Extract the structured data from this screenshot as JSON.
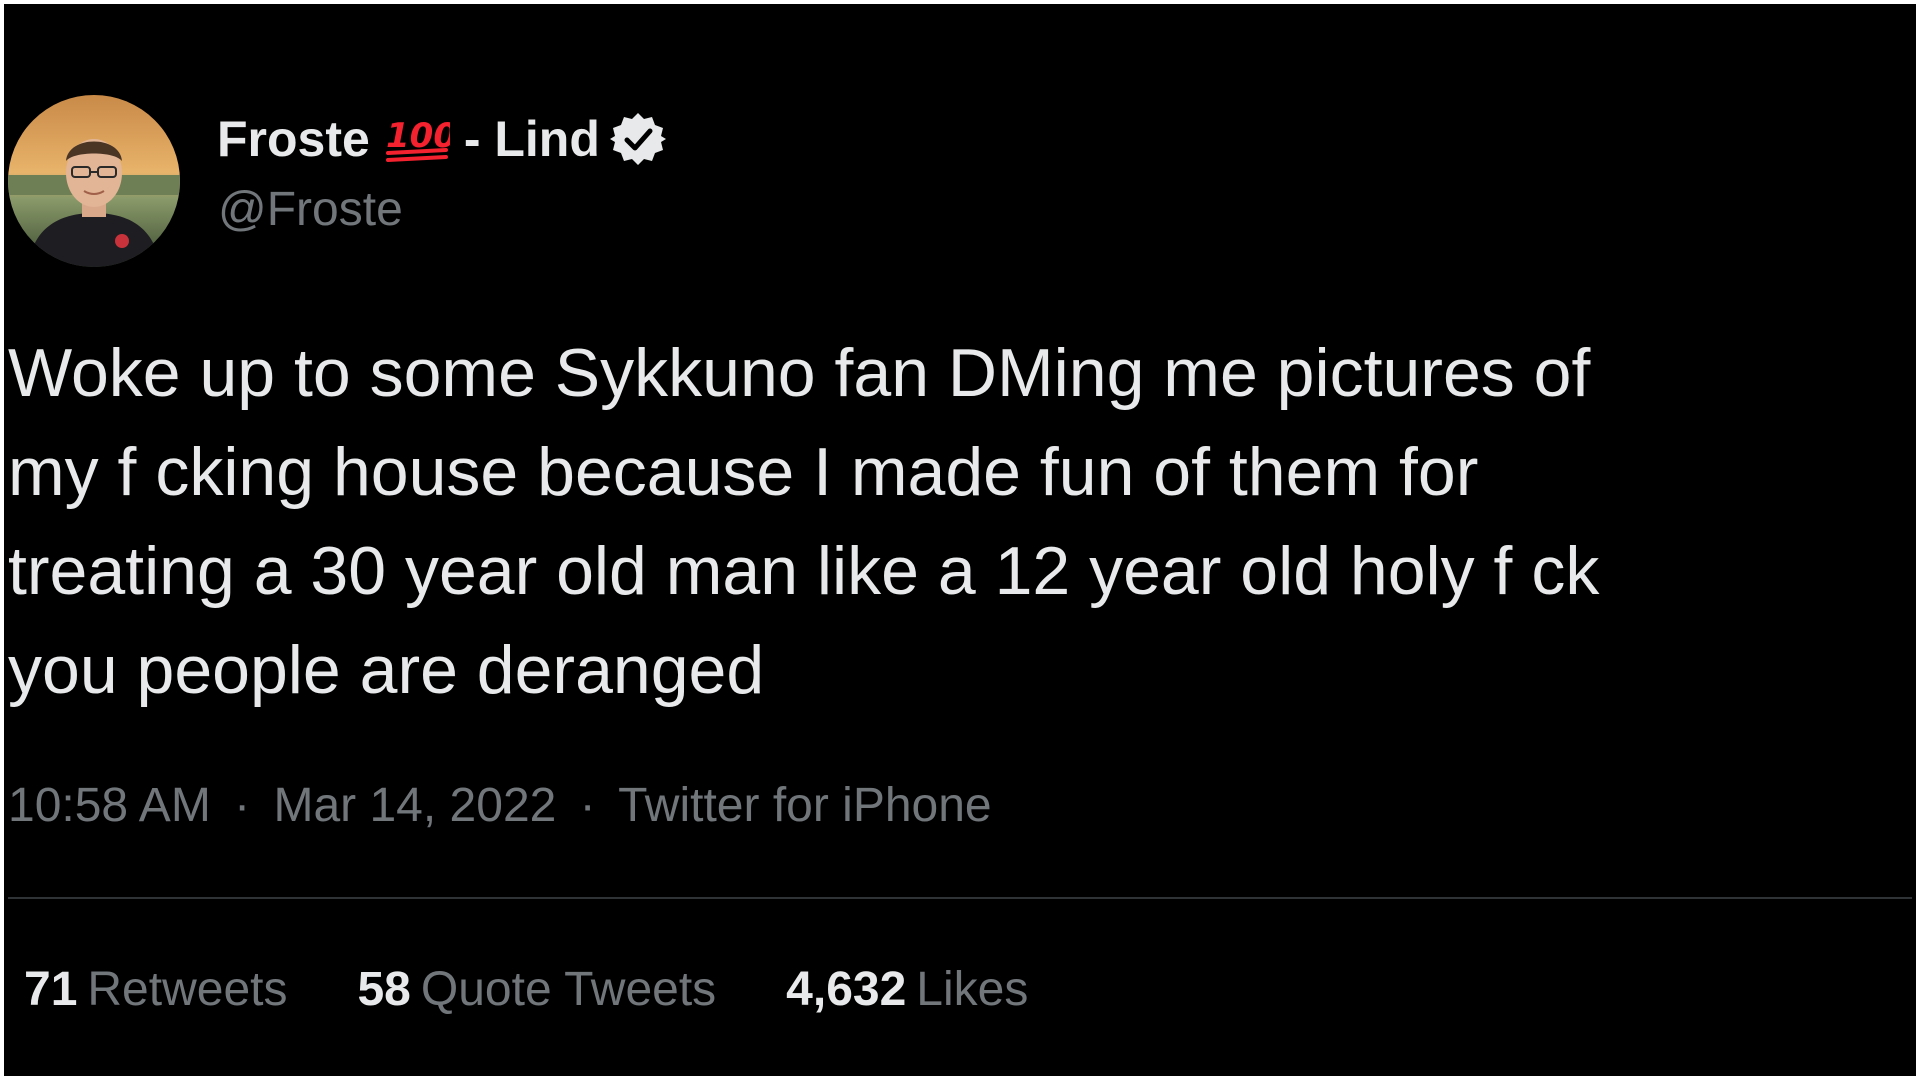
{
  "author": {
    "display_name": "Froste",
    "emoji": "100-emoji",
    "name_suffix": "- Lind",
    "verified": true,
    "handle": "@Froste"
  },
  "tweet": {
    "text": "Woke up to some Sykkuno fan DMing me pictures of\nmy f   cking house because I made fun of them for\ntreating a 30 year old man like a 12 year old holy f   ck\nyou people are deranged"
  },
  "meta": {
    "time": "10:58 AM",
    "date": "Mar 14, 2022",
    "source": "Twitter for iPhone",
    "separator": "·"
  },
  "stats": {
    "retweets": {
      "count": "71",
      "label": "Retweets"
    },
    "quote_tweets": {
      "count": "58",
      "label": "Quote Tweets"
    },
    "likes": {
      "count": "4,632",
      "label": "Likes"
    }
  },
  "colors": {
    "background": "#000000",
    "primary_text": "#e7e9ea",
    "secondary_text": "#71767b",
    "divider": "#2f3336",
    "emoji_red": "#f4212e"
  }
}
